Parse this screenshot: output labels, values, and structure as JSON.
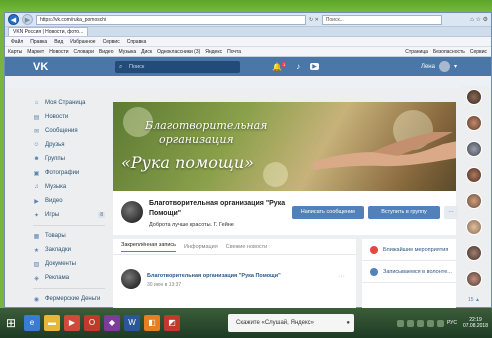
{
  "browser": {
    "url": "https://vk.com/ruka_pomoschi",
    "search_placeholder": "Поиск...",
    "tab_label": "VKN Россия | Новости, фото...",
    "menu": [
      "Файл",
      "Правка",
      "Вид",
      "Избранное",
      "Сервис",
      "Справка"
    ],
    "favorites": [
      "Карты",
      "Маркет",
      "Новости",
      "Словари",
      "Видео",
      "Музыка",
      "Диск",
      "Одноклассники (3)",
      "Яндекс",
      "Почта"
    ],
    "favorites_right": [
      "Страница",
      "Безопасность",
      "Сервис"
    ]
  },
  "vk": {
    "logo": "VK",
    "search_placeholder": "Поиск",
    "user_name": "Лена",
    "notifications_count": "1",
    "menu": [
      {
        "icon": "home-icon",
        "glyph": "⌂",
        "label": "Моя Страница"
      },
      {
        "icon": "news-icon",
        "glyph": "▤",
        "label": "Новости"
      },
      {
        "icon": "message-icon",
        "glyph": "✉",
        "label": "Сообщения"
      },
      {
        "icon": "friend-icon",
        "glyph": "☺",
        "label": "Друзья"
      },
      {
        "icon": "group-icon",
        "glyph": "☻",
        "label": "Группы"
      },
      {
        "icon": "photo-icon",
        "glyph": "▣",
        "label": "Фотографии"
      },
      {
        "icon": "music-icon",
        "glyph": "♫",
        "label": "Музыка"
      },
      {
        "icon": "video-icon",
        "glyph": "▶",
        "label": "Видео"
      },
      {
        "icon": "game-icon",
        "glyph": "✦",
        "label": "Игры",
        "counter": "8"
      }
    ],
    "menu2": [
      {
        "icon": "goods-icon",
        "glyph": "▦",
        "label": "Товары"
      },
      {
        "icon": "bookmark-icon",
        "glyph": "★",
        "label": "Закладки"
      },
      {
        "icon": "document-icon",
        "glyph": "▧",
        "label": "Документы"
      },
      {
        "icon": "ads-icon",
        "glyph": "◈",
        "label": "Реклама"
      }
    ],
    "menu3": [
      {
        "icon": "farm-icon",
        "glyph": "◉",
        "label": "Фермерские Деньги"
      }
    ],
    "cover": {
      "line1": "Благотворительная",
      "line2": "организация",
      "line3": "«Рука помощи»"
    },
    "group": {
      "name": "Благотворительная организация \"Рука Помощи\"",
      "status": "Доброта лучше красоты. Г. Гейне",
      "btn_message": "Написать сообщение",
      "btn_join": "Вступить в группу",
      "btn_more": "···"
    },
    "posts": {
      "tabs": [
        "Закреплённая запись",
        "Информация",
        "Свежие новости"
      ],
      "author": "Благотворительная организация \"Рука Помощи\"",
      "date": "30 июн в 13:37",
      "more": "···"
    },
    "side": [
      {
        "label": "Ближайшие мероприятия",
        "color": "#e64646"
      },
      {
        "label": "Записываемся в волонте...",
        "color": "#5181b8"
      }
    ],
    "friends_count": "15 ▲"
  },
  "taskbar": {
    "start": "⊞",
    "alice_text": "Скажите «Слушай, Яндекс»",
    "mic": "🎤",
    "clock_time": "22:19",
    "clock_date": "07.08.2018",
    "lang": "РУС"
  }
}
